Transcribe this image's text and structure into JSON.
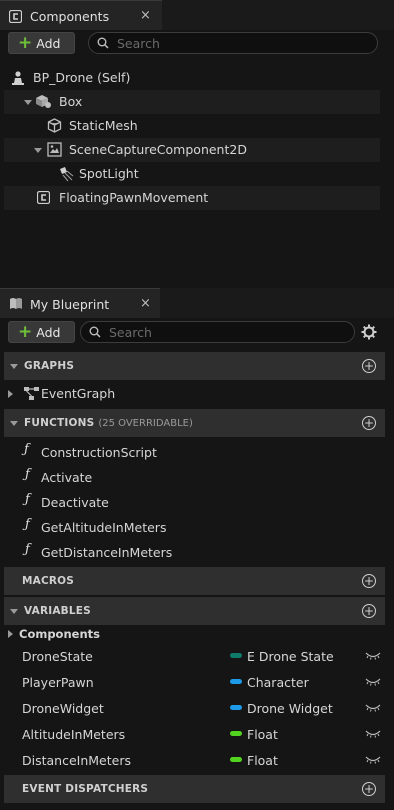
{
  "components_panel": {
    "tab_title": "Components",
    "close_glyph": "×",
    "add_label": "Add",
    "search_placeholder": "Search",
    "tree": [
      {
        "label": "BP_Drone (Self)",
        "icon": "pawn-icon"
      },
      {
        "label": "Box",
        "icon": "box-collision-icon"
      },
      {
        "label": "StaticMesh",
        "icon": "static-mesh-icon"
      },
      {
        "label": "SceneCaptureComponent2D",
        "icon": "scene-capture-icon"
      },
      {
        "label": "SpotLight",
        "icon": "spotlight-icon"
      },
      {
        "label": "FloatingPawnMovement",
        "icon": "component-icon"
      }
    ]
  },
  "blueprint_panel": {
    "tab_title": "My Blueprint",
    "close_glyph": "×",
    "add_label": "Add",
    "search_placeholder": "Search",
    "sections": {
      "graphs": "GRAPHS",
      "functions": "FUNCTIONS",
      "functions_sub": "(25 OVERRIDABLE)",
      "macros": "MACROS",
      "variables": "VARIABLES",
      "event_dispatchers": "EVENT DISPATCHERS"
    },
    "graphs": [
      "EventGraph"
    ],
    "functions": [
      "ConstructionScript",
      "Activate",
      "Deactivate",
      "GetAltitudeInMeters",
      "GetDistanceInMeters"
    ],
    "variables_category": "Components",
    "variables": [
      {
        "name": "DroneState",
        "type": "E Drone State",
        "color": "#0f7a6a"
      },
      {
        "name": "PlayerPawn",
        "type": "Character",
        "color": "#1e9be8"
      },
      {
        "name": "DroneWidget",
        "type": "Drone Widget",
        "color": "#1e9be8"
      },
      {
        "name": "AltitudeInMeters",
        "type": "Float",
        "color": "#52d31f"
      },
      {
        "name": "DistanceInMeters",
        "type": "Float",
        "color": "#52d31f"
      }
    ]
  },
  "accent_add": "#6fbf3a"
}
